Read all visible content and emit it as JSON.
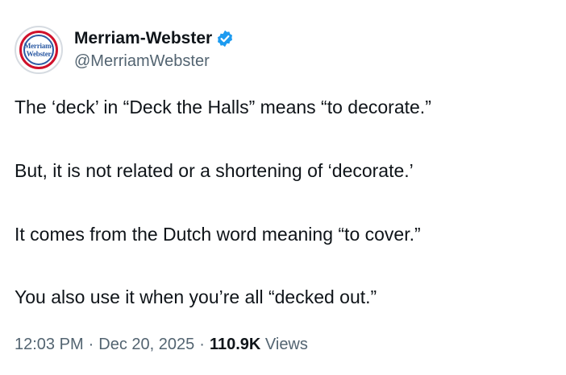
{
  "author": {
    "display_name": "Merriam-Webster",
    "handle": "@MerriamWebster",
    "avatar_text_line1": "Merriam-",
    "avatar_text_line2": "Webster",
    "verified_icon": "verified-badge-icon",
    "verified_color": "#1d9bf0"
  },
  "tweet": {
    "paragraphs": [
      "The ‘deck’ in “Deck the Halls” means “to decorate.”",
      "But, it is not related or a shortening of ‘decorate.’",
      "It comes from the Dutch word meaning “to cover.”",
      "You also use it when you’re all “decked out.”"
    ]
  },
  "meta": {
    "time": "12:03 PM",
    "separator": "·",
    "date": "Dec 20, 2025",
    "views_count": "110.9K",
    "views_label": "Views"
  },
  "colors": {
    "text_primary": "#0f1419",
    "text_secondary": "#536471",
    "brand_red": "#d0112b",
    "brand_blue": "#2d5ba4"
  }
}
